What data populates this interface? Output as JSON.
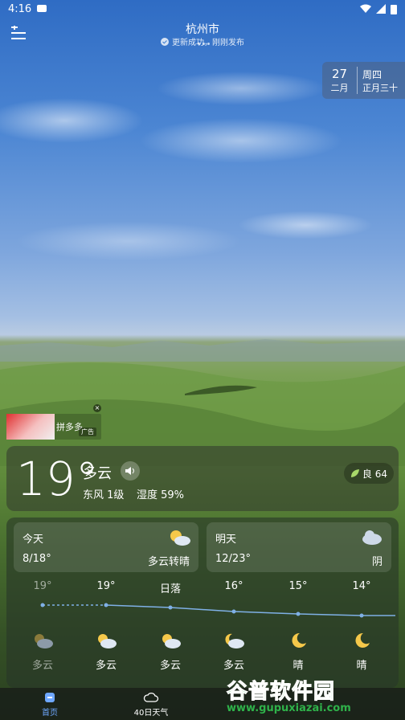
{
  "status_bar": {
    "time": "4:16"
  },
  "header": {
    "city": "杭州市",
    "update_text": "更新成功，刚刚发布"
  },
  "date": {
    "day": "27",
    "month": "二月",
    "weekday": "周四",
    "lunar": "正月三十"
  },
  "ad": {
    "name": "拼多多",
    "tag": "广告",
    "close": "×"
  },
  "current": {
    "temperature": "19°",
    "condition": "多云",
    "wind": "东风 1级",
    "humidity": "湿度 59%",
    "aqi": "良 64"
  },
  "today": {
    "label": "今天",
    "range": "8/18°",
    "condition": "多云转晴"
  },
  "tomorrow": {
    "label": "明天",
    "range": "12/23°",
    "condition": "阴"
  },
  "hourly": [
    {
      "label": "19°",
      "condition": "多云",
      "icon": "cloudy-icon"
    },
    {
      "label": "19°",
      "condition": "多云",
      "icon": "partly-cloudy-icon"
    },
    {
      "label": "日落",
      "condition": "多云",
      "icon": "partly-cloudy-icon"
    },
    {
      "label": "16°",
      "condition": "多云",
      "icon": "partly-cloudy-night-icon"
    },
    {
      "label": "15°",
      "condition": "晴",
      "icon": "moon-icon"
    },
    {
      "label": "14°",
      "condition": "晴",
      "icon": "moon-icon"
    }
  ],
  "nav": {
    "home": "首页",
    "forty_day": "40日天气"
  },
  "watermark": {
    "title": "谷普软件园",
    "url": "www.gupuxiazai.com"
  },
  "colors": {
    "accent": "#2fb24a",
    "line": "#7fb0e6",
    "sun": "#f5c84a"
  }
}
